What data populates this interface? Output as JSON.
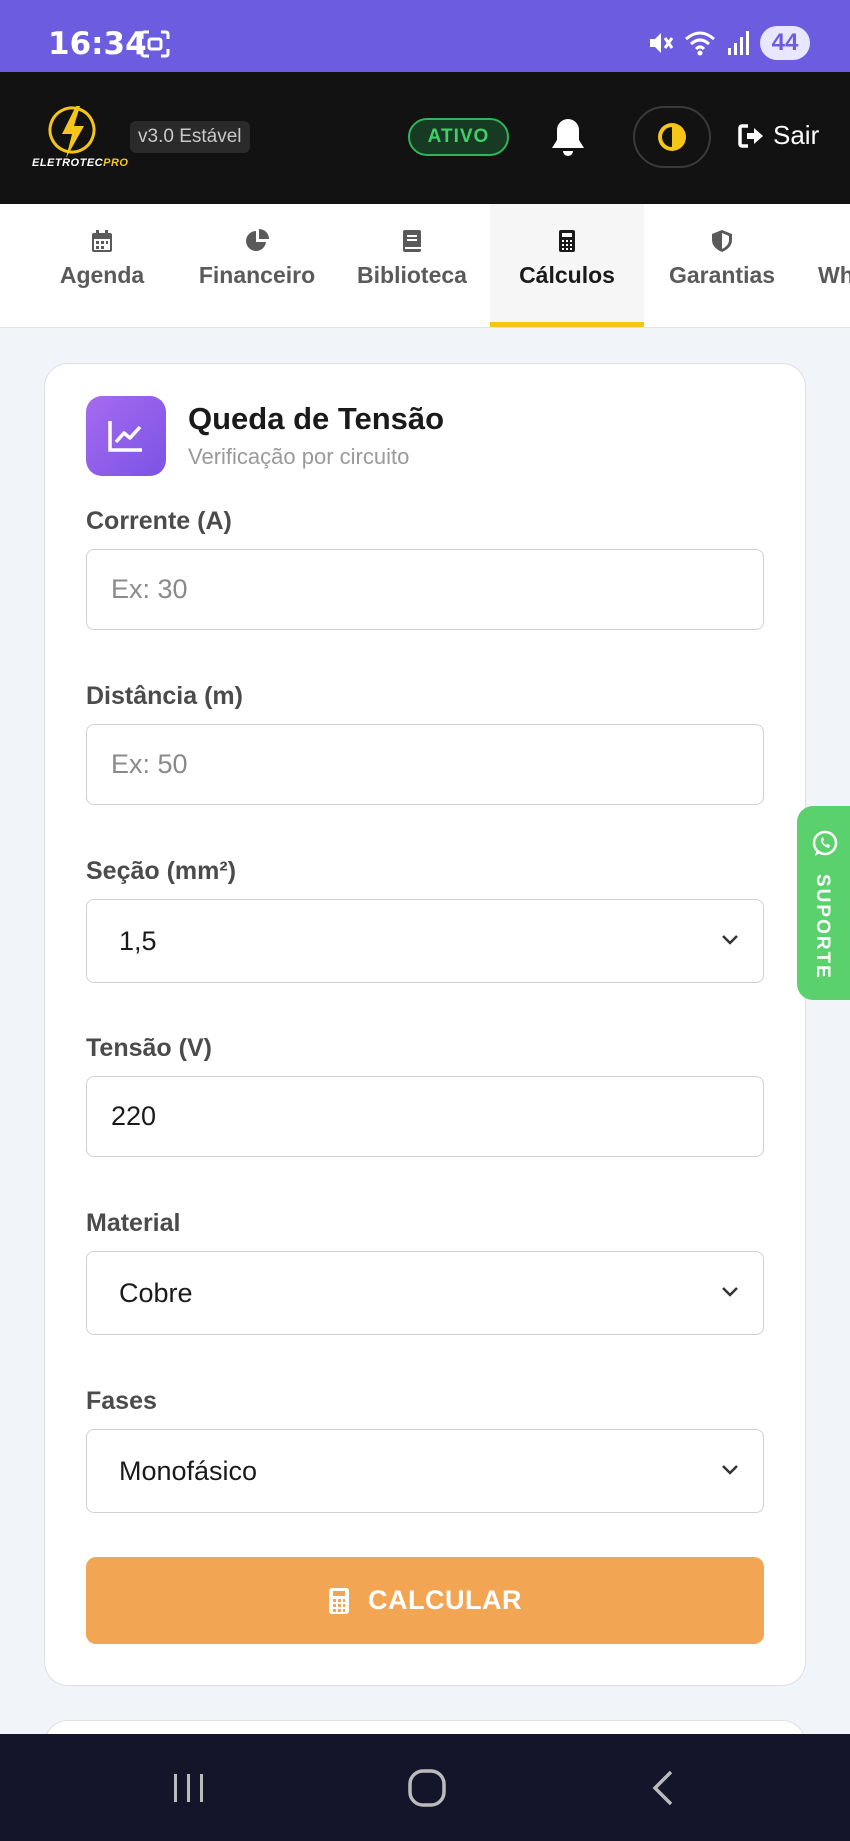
{
  "status_bar": {
    "time": "16:34",
    "battery": "44",
    "icons": [
      "screenshot-icon",
      "mute-icon",
      "wifi-icon",
      "signal-icon"
    ]
  },
  "header": {
    "logo_text_a": "ELETROTEC",
    "logo_text_b": "PRO",
    "version": "v3.0 Estável",
    "status_badge": "ATIVO",
    "logout_label": "Sair",
    "colors": {
      "background": "#121212",
      "accent": "#f5c518",
      "active_green": "#3fd06a"
    }
  },
  "tabs": [
    {
      "label": "Agenda",
      "icon": "calendar-icon",
      "active": false
    },
    {
      "label": "Financeiro",
      "icon": "pie-chart-icon",
      "active": false
    },
    {
      "label": "Biblioteca",
      "icon": "book-icon",
      "active": false
    },
    {
      "label": "Cálculos",
      "icon": "calculator-icon",
      "active": true
    },
    {
      "label": "Garantias",
      "icon": "shield-icon",
      "active": false
    },
    {
      "label": "Wh",
      "icon": "",
      "active": false
    }
  ],
  "card": {
    "title": "Queda de Tensão",
    "subtitle": "Verificação por circuito",
    "icon": "line-chart-icon",
    "fields": {
      "corrente": {
        "label": "Corrente (A)",
        "placeholder": "Ex: 30",
        "value": ""
      },
      "distancia": {
        "label": "Distância (m)",
        "placeholder": "Ex: 50",
        "value": ""
      },
      "secao": {
        "label": "Seção (mm²)",
        "selected": "1,5"
      },
      "tensao": {
        "label": "Tensão (V)",
        "value": "220"
      },
      "material": {
        "label": "Material",
        "selected": "Cobre"
      },
      "fases": {
        "label": "Fases",
        "selected": "Monofásico"
      }
    },
    "calculate_label": "CALCULAR",
    "colors": {
      "button": "#f2a654",
      "icon_gradient_start": "#a66bf0",
      "icon_gradient_end": "#7b53e4"
    }
  },
  "support": {
    "label": "SUPORTE",
    "icon": "whatsapp-icon",
    "color": "#5bd16d"
  },
  "nav": {
    "buttons": [
      "recent-apps-icon",
      "home-icon",
      "back-icon"
    ]
  }
}
